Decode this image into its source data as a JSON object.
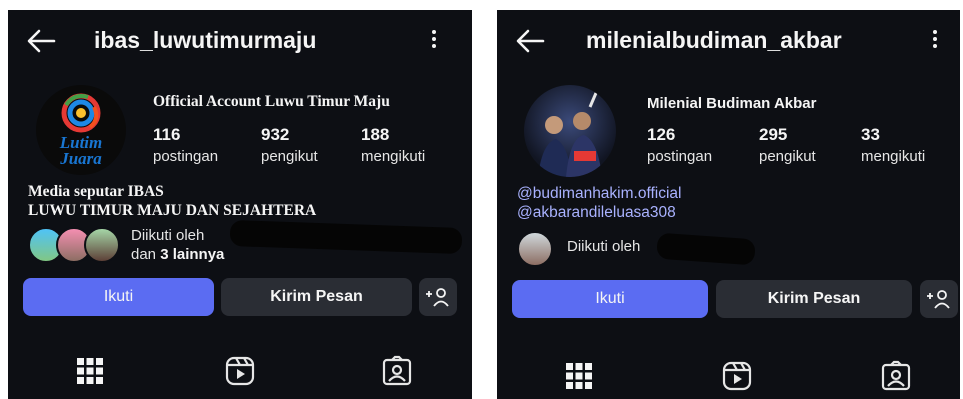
{
  "left": {
    "handle": "ibas_luwutimurmaju",
    "display_name": "Official Account Luwu Timur Maju",
    "avatar_text_top": "Lutim",
    "avatar_text_bottom": "Juara",
    "stats": [
      {
        "value": "116",
        "label": "postingan"
      },
      {
        "value": "932",
        "label": "pengikut"
      },
      {
        "value": "188",
        "label": "mengikuti"
      }
    ],
    "bio": [
      "Media seputar IBAS",
      "LUWU TIMUR MAJU DAN SEJAHTERA"
    ],
    "followed_by": "Diikuti oleh",
    "followed_and": "dan",
    "followed_count": "3 lainnya",
    "follow_label": "Ikuti",
    "message_label": "Kirim Pesan"
  },
  "right": {
    "handle": "milenialbudiman_akbar",
    "display_name": "Milenial Budiman Akbar",
    "stats": [
      {
        "value": "126",
        "label": "postingan"
      },
      {
        "value": "295",
        "label": "pengikut"
      },
      {
        "value": "33",
        "label": "mengikuti"
      }
    ],
    "links": [
      "@budimanhakim.official",
      "@akbarandileluasa308"
    ],
    "followed_by": "Diikuti oleh",
    "follow_label": "Ikuti",
    "message_label": "Kirim Pesan"
  },
  "icons": {
    "back": "arrow-left-icon",
    "menu": "kebab-menu-icon",
    "add_user": "add-user-icon",
    "grid": "grid-icon",
    "reels": "reels-icon",
    "tagged": "tagged-icon"
  },
  "colors": {
    "background": "#0d0f14",
    "primary_button": "#5b6cf2",
    "secondary_button": "#2a2d34",
    "link": "#a9b2ff"
  }
}
